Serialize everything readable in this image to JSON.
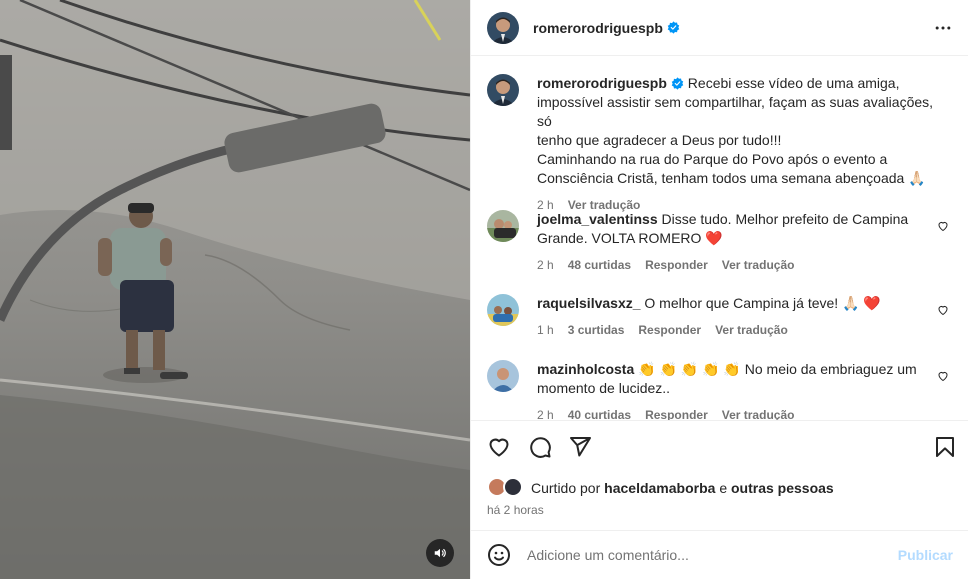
{
  "video": {
    "mute_icon": "speaker-icon"
  },
  "post": {
    "author": "romerorodriguespb",
    "verified": true,
    "caption_lines": [
      "Recebi esse vídeo de uma amiga,",
      "impossível assistir sem compartilhar, façam as suas avaliações, só",
      "tenho que agradecer a Deus por tudo!!!",
      "Caminhando na rua do Parque do Povo após o evento a",
      "Consciência Cristã, tenham todos uma semana abençoada 🙏🏻"
    ],
    "caption_time": "2 h",
    "caption_translate": "Ver tradução"
  },
  "comments": [
    {
      "user": "joelma_valentinss",
      "lines": [
        "Disse tudo. Melhor prefeito de Campina",
        "Grande. VOLTA ROMERO ❤️"
      ],
      "time": "2 h",
      "likes": "48 curtidas",
      "reply": "Responder",
      "translate": "Ver tradução"
    },
    {
      "user": "raquelsilvasxz_",
      "lines": [
        "O melhor que Campina já teve! 🙏🏻 ❤️"
      ],
      "time": "1 h",
      "likes": "3 curtidas",
      "reply": "Responder",
      "translate": "Ver tradução"
    },
    {
      "user": "mazinholcosta",
      "lines": [
        "👏 👏 👏 👏 👏 No meio da embriaguez um",
        "momento de lucidez.."
      ],
      "time": "2 h",
      "likes": "40 curtidas",
      "reply": "Responder",
      "translate": "Ver tradução"
    }
  ],
  "liked_by": {
    "prefix": "Curtido por",
    "user": "haceldamaborba",
    "conj": "e",
    "others": "outras pessoas"
  },
  "post_time": "há 2 horas",
  "add_comment": {
    "placeholder": "Adicione um comentário...",
    "publish": "Publicar"
  },
  "colors": {
    "accent": "#0095f6",
    "publish_disabled": "#b3dbff",
    "like_red": "#ed4956",
    "verified": "#0095f6",
    "muted": "#737373"
  }
}
